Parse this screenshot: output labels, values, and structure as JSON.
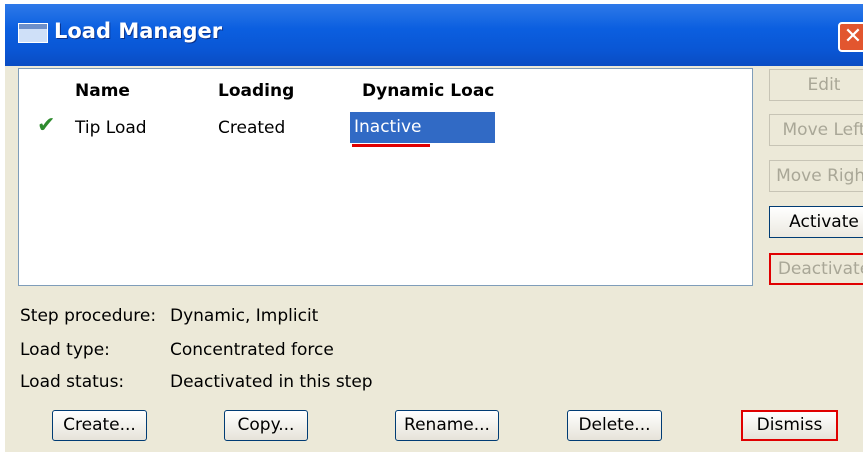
{
  "window": {
    "title": "Load Manager",
    "close_glyph": "✕"
  },
  "table": {
    "headers": {
      "name": "Name",
      "loading": "Loading",
      "dynamic": "Dynamic Loac"
    },
    "rows": [
      {
        "checked": "✔",
        "name": "Tip Load",
        "loading": "Created",
        "dynamic": "Inactive"
      }
    ]
  },
  "side_buttons": {
    "edit": "Edit",
    "move_left": "Move Left",
    "move_right": "Move Right",
    "activate": "Activate",
    "deactivate": "Deactivate"
  },
  "info": {
    "step_procedure_label": "Step procedure:",
    "step_procedure_value": "Dynamic, Implicit",
    "load_type_label": "Load type:",
    "load_type_value": "Concentrated force",
    "load_status_label": "Load status:",
    "load_status_value": "Deactivated in this step"
  },
  "buttons": {
    "create": "Create...",
    "copy": "Copy...",
    "rename": "Rename...",
    "delete": "Delete...",
    "dismiss": "Dismiss"
  },
  "colors": {
    "titlebar": "#0a56d4",
    "selection": "#316ac5",
    "highlight": "#e00000"
  },
  "icons": {
    "window_icon": "window-icon",
    "close": "close-icon",
    "check": "check-icon"
  }
}
